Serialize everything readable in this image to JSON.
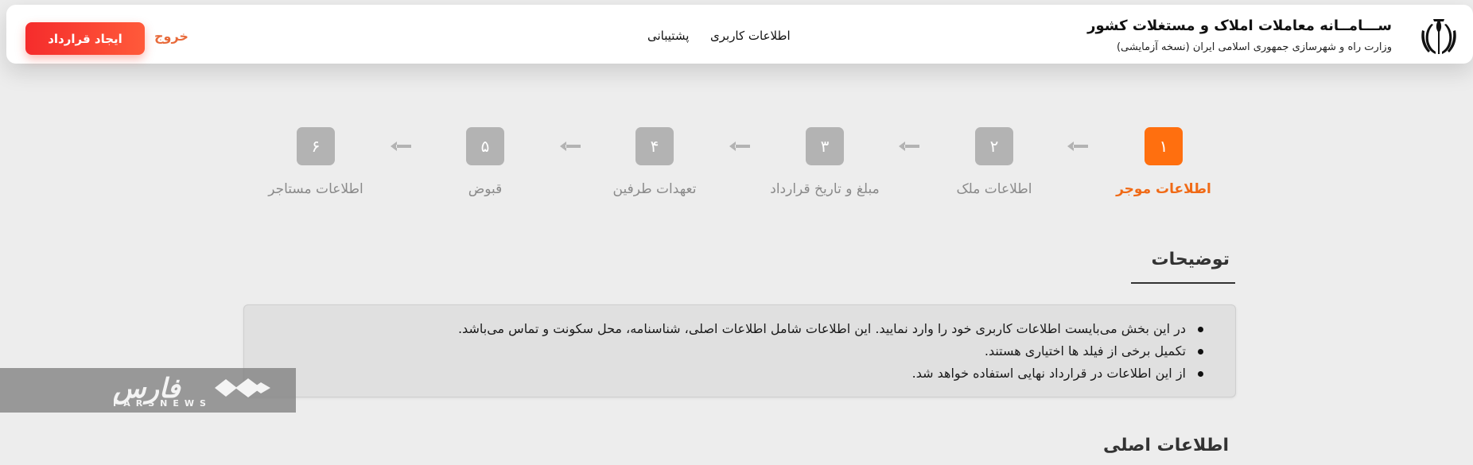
{
  "header": {
    "title": "ســـامــانه معاملات املاک و مستغلات کشور",
    "subtitle": "وزارت راه و شهرسازی جمهوری اسلامی ایران (نسخه آزمایشی)",
    "nav": {
      "user_info": "اطلاعات کاربری",
      "support": "پشتیبانی"
    },
    "logout": "خروج",
    "create_contract": "ایجاد قرارداد"
  },
  "stepper": {
    "steps": [
      {
        "number": "۱",
        "label": "اطلاعات موجر",
        "active": true
      },
      {
        "number": "۲",
        "label": "اطلاعات ملک",
        "active": false
      },
      {
        "number": "۳",
        "label": "مبلغ و تاریخ قرارداد",
        "active": false
      },
      {
        "number": "۴",
        "label": "تعهدات طرفین",
        "active": false
      },
      {
        "number": "۵",
        "label": "قبوض",
        "active": false
      },
      {
        "number": "۶",
        "label": "اطلاعات مستاجر",
        "active": false
      }
    ]
  },
  "description": {
    "heading": "توضیحات",
    "items": [
      "در این بخش می‌بایست اطلاعات کاربری خود را وارد نمایید. این اطلاعات شامل اطلاعات اصلی، شناسنامه، محل سکونت و تماس می‌باشد.",
      "تکمیل برخی از فیلد ها اختیاری هستند.",
      "از این اطلاعات در قرارداد نهایی استفاده خواهد شد."
    ]
  },
  "main_info": {
    "heading": "اطلاعات اصلی"
  },
  "watermark": {
    "name": "فارس",
    "sub": "FARSNEWS"
  },
  "colors": {
    "accent": "#ff6f0f",
    "inactive_step": "#b3b3b3",
    "button_red": "#f52c2c",
    "logout": "#e86a3a"
  }
}
